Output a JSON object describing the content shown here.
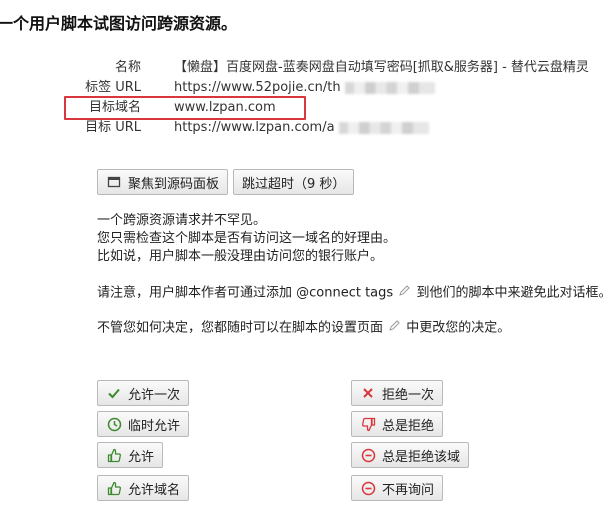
{
  "heading": "一个用户脚本试图访问跨源资源。",
  "info": {
    "name_label": "名称",
    "name_value": "【懒盘】百度网盘-蓝奏网盘自动填写密码[抓取&服务器] - 替代云盘精灵",
    "tag_url_label": "标签 URL",
    "tag_url_value": "https://www.52pojie.cn/th",
    "target_domain_label": "目标域名",
    "target_domain_value": "www.lzpan.com",
    "target_url_label": "目标 URL",
    "target_url_value": "https://www.lzpan.com/a"
  },
  "buttons": {
    "focus_source": "聚焦到源码面板",
    "skip_timeout": "跳过超时（9 秒）",
    "allow_once": "允许一次",
    "allow_temp": "临时允许",
    "allow": "允许",
    "allow_domain": "允许域名",
    "deny_once": "拒绝一次",
    "always_deny": "总是拒绝",
    "always_deny_domain": "总是拒绝该域",
    "never_ask": "不再询问"
  },
  "messages": {
    "line1": "一个跨源资源请求并不罕见。",
    "line2": "您只需检查这个脚本是否有访问这一域名的好理由。",
    "line3": "比如说，用户脚本一般没理由访问您的银行账户。",
    "line4_pre": "请注意，用户脚本作者可通过添加 @connect tags",
    "line4_post": "到他们的脚本中来避免此对话框。",
    "line5_pre": "不管您如何决定，您都随时可以在脚本的设置页面",
    "line5_post": "中更改您的决定。"
  },
  "colors": {
    "accent_green": "#3c8a2e",
    "accent_red": "#d9363e",
    "highlight_border": "#d9363e"
  },
  "icons": [
    "source-panel-icon",
    "check-icon",
    "clock-icon",
    "thumbs-up-icon",
    "close-icon",
    "thumbs-down-icon",
    "minus-circle-icon",
    "pencil-icon"
  ]
}
